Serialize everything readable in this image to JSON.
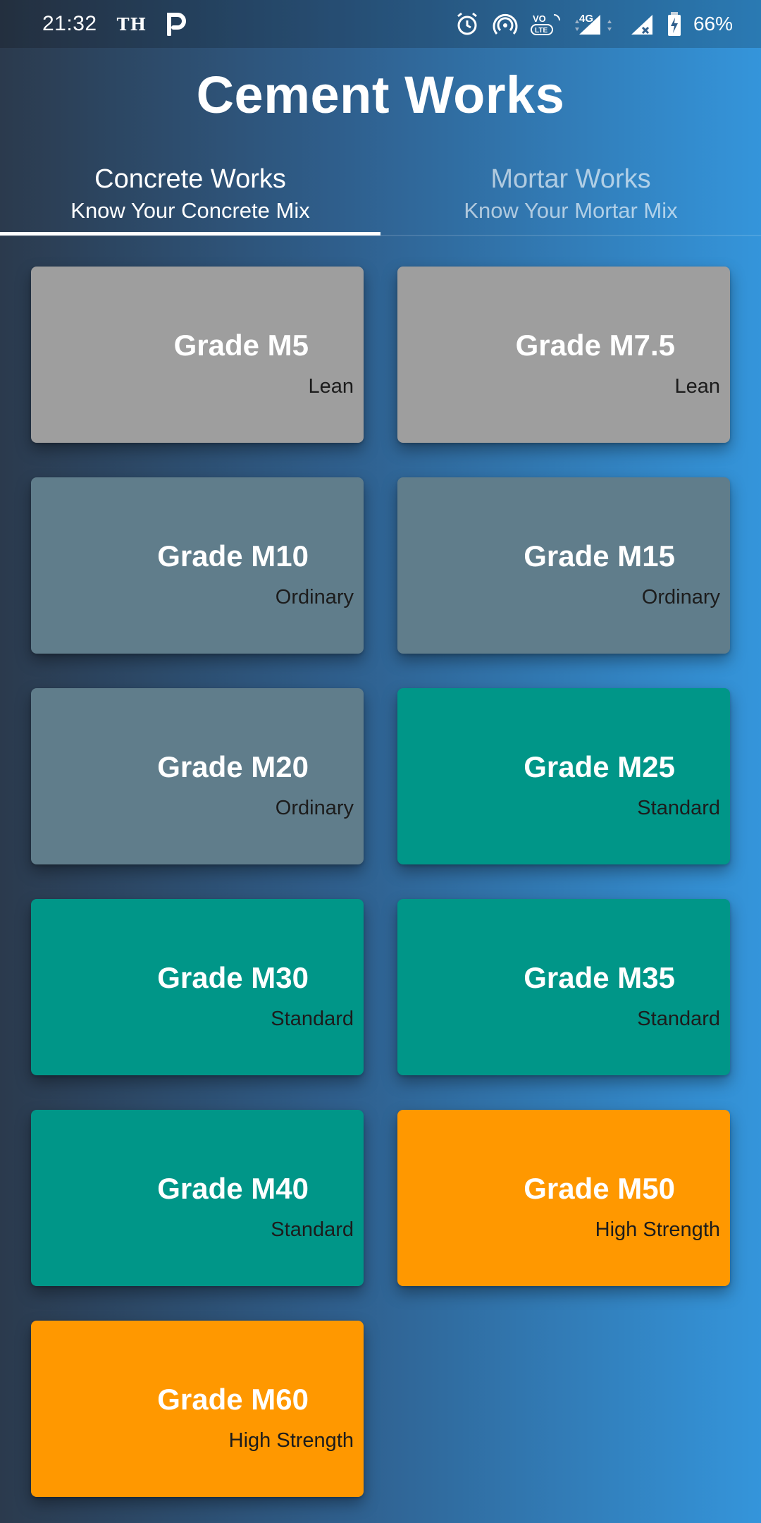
{
  "status_bar": {
    "time": "21:32",
    "carrier_tag": "TH",
    "network": "4G",
    "battery": "66%",
    "icons": [
      "p-app-icon",
      "alarm-icon",
      "hotspot-icon",
      "volte-icon",
      "signal-icon",
      "signal-no-data-icon",
      "battery-icon"
    ]
  },
  "header": {
    "title": "Cement Works"
  },
  "tabs": [
    {
      "label": "Concrete Works",
      "subtitle": "Know Your Concrete Mix",
      "active": true
    },
    {
      "label": "Mortar Works",
      "subtitle": "Know Your Mortar Mix",
      "active": false
    }
  ],
  "colors": {
    "lean": "#9e9e9e",
    "ordinary": "#607d8b",
    "standard": "#009688",
    "high_strength": "#ff9800"
  },
  "grades": [
    {
      "title": "Grade M5",
      "category": "Lean",
      "color": "#9e9e9e"
    },
    {
      "title": "Grade M7.5",
      "category": "Lean",
      "color": "#9e9e9e"
    },
    {
      "title": "Grade M10",
      "category": "Ordinary",
      "color": "#607d8b"
    },
    {
      "title": "Grade M15",
      "category": "Ordinary",
      "color": "#607d8b"
    },
    {
      "title": "Grade M20",
      "category": "Ordinary",
      "color": "#607d8b"
    },
    {
      "title": "Grade M25",
      "category": "Standard",
      "color": "#009688"
    },
    {
      "title": "Grade M30",
      "category": "Standard",
      "color": "#009688"
    },
    {
      "title": "Grade M35",
      "category": "Standard",
      "color": "#009688"
    },
    {
      "title": "Grade M40",
      "category": "Standard",
      "color": "#009688"
    },
    {
      "title": "Grade M50",
      "category": "High Strength",
      "color": "#ff9800"
    },
    {
      "title": "Grade M60",
      "category": "High Strength",
      "color": "#ff9800"
    }
  ]
}
